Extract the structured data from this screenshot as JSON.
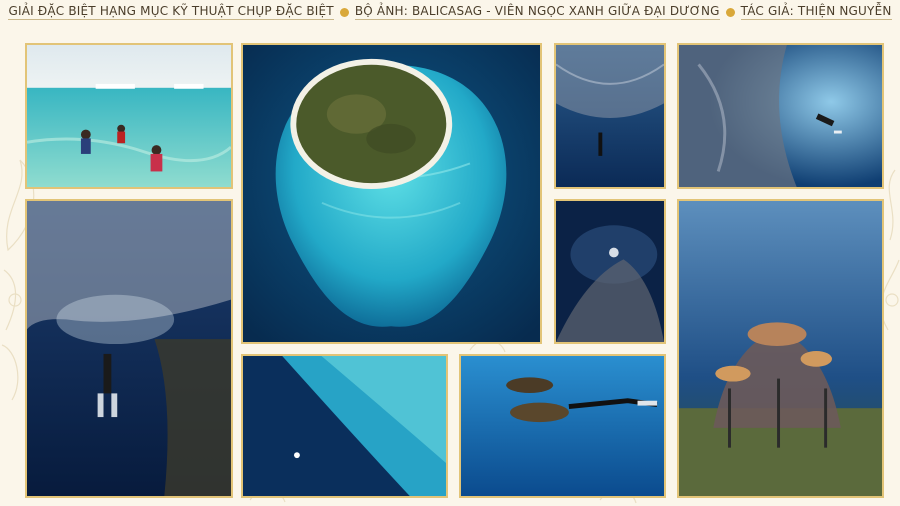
{
  "header": {
    "award": "GIẢI ĐẶC BIỆT HẠNG MỤC KỸ THUẬT CHỤP ĐẶC BIỆT",
    "series": "BỘ ẢNH: BALICASAG - VIÊN NGỌC XANH GIỮA ĐẠI DƯƠNG",
    "author": "TÁC GIẢ: THIỆN NGUYỄN"
  },
  "colors": {
    "frame": "#e2c477",
    "bullet": "#d9a83a",
    "background": "#fbf6ea"
  },
  "photos": [
    "snorkelers-shallow-reef-photo",
    "island-aerial-photo",
    "diver-in-sardine-school-photo",
    "diver-beside-fish-vortex-photo",
    "freediver-under-sardine-ball-photo",
    "diver-looking-through-sardine-ring-photo",
    "reef-edge-aerial-photo",
    "turtles-and-diver-photo",
    "coral-dome-structure-photo"
  ]
}
